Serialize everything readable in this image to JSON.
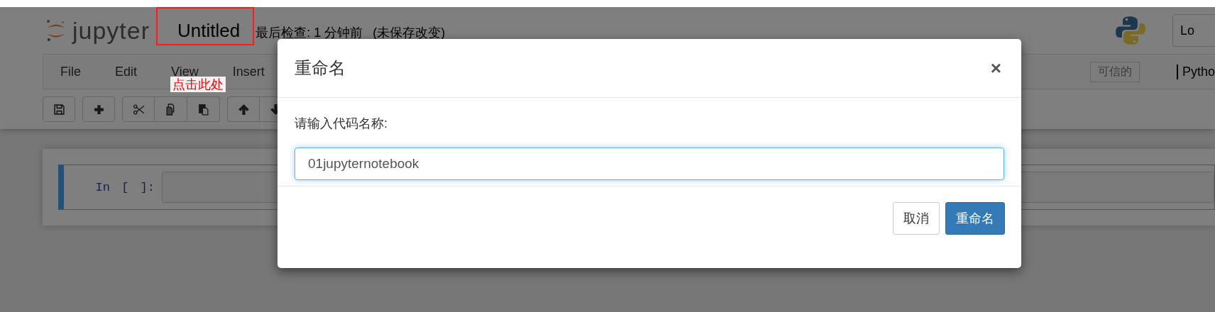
{
  "header": {
    "logo_text": "jupyter",
    "notebook_name": "Untitled",
    "checkpoint": "最后检查: 1 分钟前",
    "unsaved": "(未保存改变)",
    "logout_button": "Lo"
  },
  "menu": [
    "File",
    "Edit",
    "View",
    "Insert"
  ],
  "trusted_badge": "可信的",
  "kernel": "Pytho",
  "toolbar": [
    [
      {
        "kind": "save"
      }
    ],
    [
      {
        "kind": "add"
      }
    ],
    [
      {
        "kind": "cut"
      },
      {
        "kind": "copy"
      },
      {
        "kind": "paste"
      }
    ],
    [
      {
        "kind": "up"
      },
      {
        "kind": "down"
      }
    ]
  ],
  "cell": {
    "prompt": "In [ ]:",
    "selected": true
  },
  "annotation": {
    "text": "点击此处"
  },
  "dialog": {
    "title": "重命名",
    "close": "×",
    "label": "请输入代码名称:",
    "input_value": "01jupyternotebook",
    "buttons": [
      {
        "label": "取消",
        "kind": "default"
      },
      {
        "label": "重命名",
        "kind": "primary"
      }
    ]
  }
}
